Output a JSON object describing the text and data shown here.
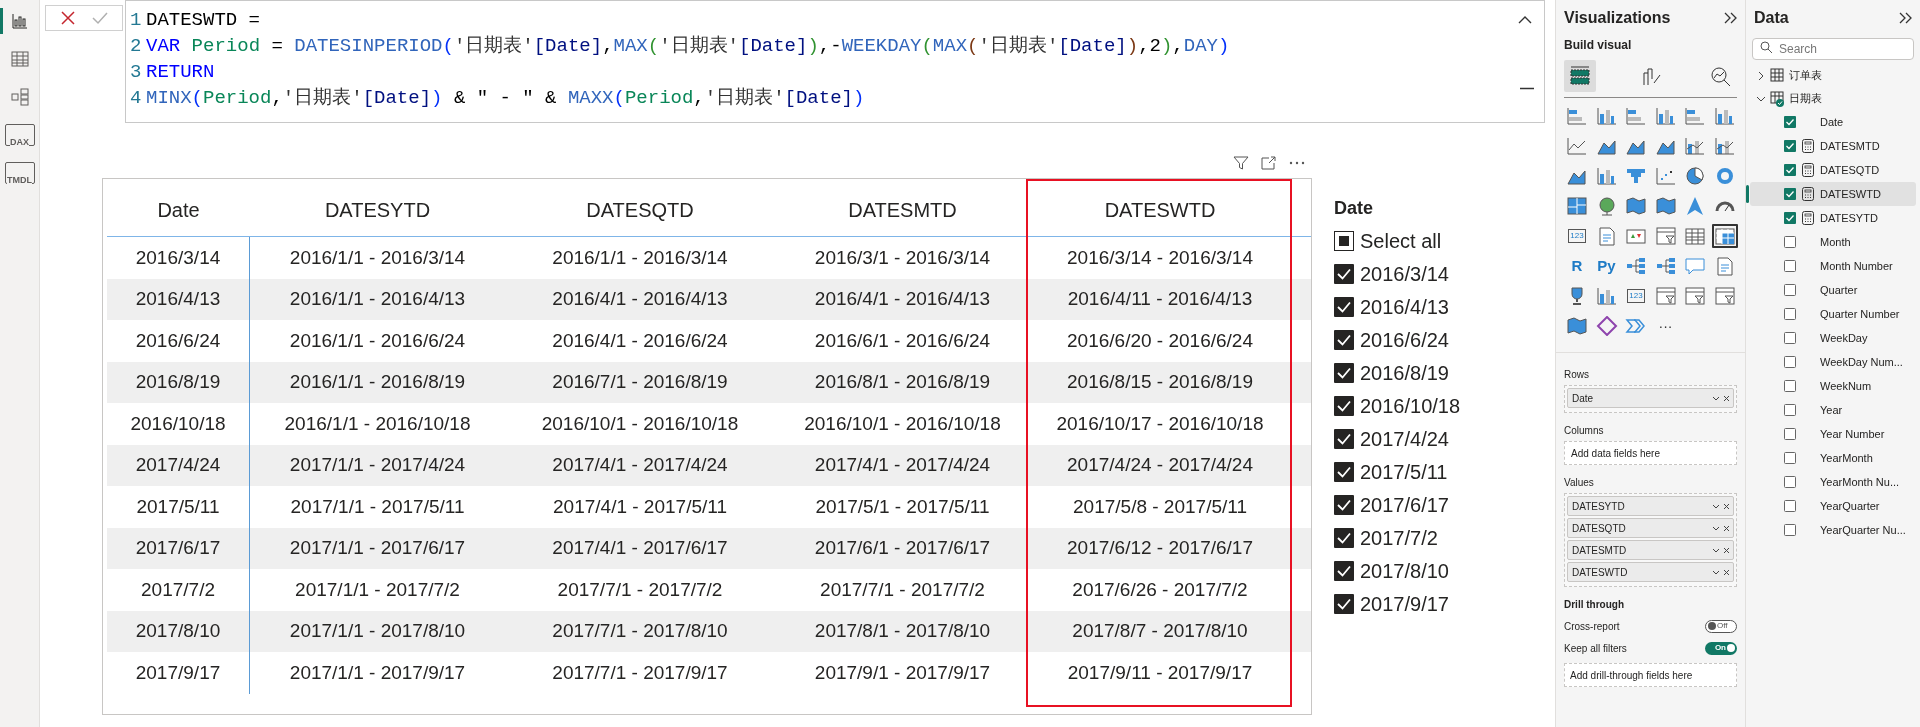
{
  "rail": [
    {
      "kind": "report",
      "selected": true
    },
    {
      "kind": "table",
      "selected": false
    },
    {
      "kind": "model",
      "selected": false
    },
    {
      "kind": "dax",
      "label": "DAX",
      "selected": false
    },
    {
      "kind": "tmdl",
      "label": "TMDL",
      "selected": false
    }
  ],
  "formula": {
    "lines": [
      {
        "number": "1",
        "tokens": [
          {
            "kind": "plain",
            "text": "DATESWTD ="
          }
        ]
      },
      {
        "number": "2",
        "tokens": [
          {
            "kind": "kw",
            "text": "VAR"
          },
          {
            "kind": "var",
            "text": " Period"
          },
          {
            "kind": "plain",
            "text": " = "
          },
          {
            "kind": "fn",
            "text": "DATESINPERIOD"
          },
          {
            "kind": "p1",
            "text": "("
          },
          {
            "kind": "tbl",
            "text": "'日期表'"
          },
          {
            "kind": "col",
            "text": "[Date]"
          },
          {
            "kind": "plain",
            "text": ","
          },
          {
            "kind": "fn",
            "text": "MAX"
          },
          {
            "kind": "p2",
            "text": "("
          },
          {
            "kind": "tbl",
            "text": "'日期表'"
          },
          {
            "kind": "col",
            "text": "[Date]"
          },
          {
            "kind": "p2",
            "text": ")"
          },
          {
            "kind": "plain",
            "text": ",-"
          },
          {
            "kind": "fn",
            "text": "WEEKDAY"
          },
          {
            "kind": "p2",
            "text": "("
          },
          {
            "kind": "fn",
            "text": "MAX"
          },
          {
            "kind": "p3",
            "text": "("
          },
          {
            "kind": "tbl",
            "text": "'日期表'"
          },
          {
            "kind": "col",
            "text": "[Date]"
          },
          {
            "kind": "p3",
            "text": ")"
          },
          {
            "kind": "plain",
            "text": ",2"
          },
          {
            "kind": "p2",
            "text": ")"
          },
          {
            "kind": "plain",
            "text": ","
          },
          {
            "kind": "fn",
            "text": "DAY"
          },
          {
            "kind": "p1",
            "text": ")"
          }
        ]
      },
      {
        "number": "3",
        "tokens": [
          {
            "kind": "kw",
            "text": "RETURN"
          }
        ]
      },
      {
        "number": "4",
        "tokens": [
          {
            "kind": "fn",
            "text": "MINX"
          },
          {
            "kind": "p1",
            "text": "("
          },
          {
            "kind": "var",
            "text": "Period"
          },
          {
            "kind": "plain",
            "text": ","
          },
          {
            "kind": "tbl",
            "text": "'日期表'"
          },
          {
            "kind": "col",
            "text": "[Date]"
          },
          {
            "kind": "p1",
            "text": ")"
          },
          {
            "kind": "plain",
            "text": " & \" - \" & "
          },
          {
            "kind": "fn",
            "text": "MAXX"
          },
          {
            "kind": "p1",
            "text": "("
          },
          {
            "kind": "var",
            "text": "Period"
          },
          {
            "kind": "plain",
            "text": ","
          },
          {
            "kind": "tbl",
            "text": "'日期表'"
          },
          {
            "kind": "col",
            "text": "[Date]"
          },
          {
            "kind": "p1",
            "text": ")"
          }
        ]
      }
    ]
  },
  "table": {
    "columns": [
      {
        "label": "Date",
        "highlighted": false
      },
      {
        "label": "DATESYTD",
        "highlighted": false
      },
      {
        "label": "DATESQTD",
        "highlighted": false
      },
      {
        "label": "DATESMTD",
        "highlighted": false
      },
      {
        "label": "DATESWTD",
        "highlighted": true
      }
    ],
    "rows": [
      [
        "2016/3/14",
        "2016/1/1 - 2016/3/14",
        "2016/1/1 - 2016/3/14",
        "2016/3/1 - 2016/3/14",
        "2016/3/14 - 2016/3/14"
      ],
      [
        "2016/4/13",
        "2016/1/1 - 2016/4/13",
        "2016/4/1 - 2016/4/13",
        "2016/4/1 - 2016/4/13",
        "2016/4/11 - 2016/4/13"
      ],
      [
        "2016/6/24",
        "2016/1/1 - 2016/6/24",
        "2016/4/1 - 2016/6/24",
        "2016/6/1 - 2016/6/24",
        "2016/6/20 - 2016/6/24"
      ],
      [
        "2016/8/19",
        "2016/1/1 - 2016/8/19",
        "2016/7/1 - 2016/8/19",
        "2016/8/1 - 2016/8/19",
        "2016/8/15 - 2016/8/19"
      ],
      [
        "2016/10/18",
        "2016/1/1 - 2016/10/18",
        "2016/10/1 - 2016/10/18",
        "2016/10/1 - 2016/10/18",
        "2016/10/17 - 2016/10/18"
      ],
      [
        "2017/4/24",
        "2017/1/1 - 2017/4/24",
        "2017/4/1 - 2017/4/24",
        "2017/4/1 - 2017/4/24",
        "2017/4/24 - 2017/4/24"
      ],
      [
        "2017/5/11",
        "2017/1/1 - 2017/5/11",
        "2017/4/1 - 2017/5/11",
        "2017/5/1 - 2017/5/11",
        "2017/5/8 - 2017/5/11"
      ],
      [
        "2017/6/17",
        "2017/1/1 - 2017/6/17",
        "2017/4/1 - 2017/6/17",
        "2017/6/1 - 2017/6/17",
        "2017/6/12 - 2017/6/17"
      ],
      [
        "2017/7/2",
        "2017/1/1 - 2017/7/2",
        "2017/7/1 - 2017/7/2",
        "2017/7/1 - 2017/7/2",
        "2017/6/26 - 2017/7/2"
      ],
      [
        "2017/8/10",
        "2017/1/1 - 2017/8/10",
        "2017/7/1 - 2017/8/10",
        "2017/8/1 - 2017/8/10",
        "2017/8/7 - 2017/8/10"
      ],
      [
        "2017/9/17",
        "2017/1/1 - 2017/9/17",
        "2017/7/1 - 2017/9/17",
        "2017/9/1 - 2017/9/17",
        "2017/9/11 - 2017/9/17"
      ]
    ]
  },
  "slicer": {
    "title": "Date",
    "select_all": {
      "label": "Select all",
      "indeterminate": true
    },
    "items": [
      {
        "label": "2016/3/14",
        "checked": true
      },
      {
        "label": "2016/4/13",
        "checked": true
      },
      {
        "label": "2016/6/24",
        "checked": true
      },
      {
        "label": "2016/8/19",
        "checked": true
      },
      {
        "label": "2016/10/18",
        "checked": true
      },
      {
        "label": "2017/4/24",
        "checked": true
      },
      {
        "label": "2017/5/11",
        "checked": true
      },
      {
        "label": "2017/6/17",
        "checked": true
      },
      {
        "label": "2017/7/2",
        "checked": true
      },
      {
        "label": "2017/8/10",
        "checked": true
      },
      {
        "label": "2017/9/17",
        "checked": true
      }
    ]
  },
  "visualizations": {
    "title": "Visualizations",
    "subtitle": "Build visual",
    "build_tabs": [
      {
        "kind": "build",
        "selected": true
      },
      {
        "kind": "format",
        "selected": false
      },
      {
        "kind": "analytics",
        "selected": false
      }
    ],
    "gallery": [
      {
        "kind": "hbar",
        "selected": false
      },
      {
        "kind": "vbar",
        "selected": false
      },
      {
        "kind": "hbar",
        "selected": false
      },
      {
        "kind": "vbar",
        "selected": false
      },
      {
        "kind": "hbar",
        "selected": false
      },
      {
        "kind": "vbar",
        "selected": false
      },
      {
        "kind": "line",
        "selected": false
      },
      {
        "kind": "area",
        "selected": false
      },
      {
        "kind": "area",
        "selected": false
      },
      {
        "kind": "area",
        "selected": false
      },
      {
        "kind": "linecol",
        "selected": false
      },
      {
        "kind": "linecol",
        "selected": false
      },
      {
        "kind": "area",
        "selected": false
      },
      {
        "kind": "vbar",
        "selected": false
      },
      {
        "kind": "funnel",
        "selected": false
      },
      {
        "kind": "scatter",
        "selected": false
      },
      {
        "kind": "pie",
        "selected": false
      },
      {
        "kind": "donut",
        "selected": false
      },
      {
        "kind": "treemap",
        "selected": false
      },
      {
        "kind": "globe",
        "selected": false
      },
      {
        "kind": "map",
        "selected": false
      },
      {
        "kind": "map",
        "selected": false
      },
      {
        "kind": "arrow",
        "selected": false
      },
      {
        "kind": "gauge",
        "selected": false
      },
      {
        "kind": "card",
        "label": "123",
        "selected": false
      },
      {
        "kind": "doc",
        "selected": false
      },
      {
        "kind": "kpi",
        "selected": false
      },
      {
        "kind": "slicer",
        "selected": false
      },
      {
        "kind": "table",
        "selected": false
      },
      {
        "kind": "matrix",
        "selected": true
      },
      {
        "kind": "letter",
        "label": "R",
        "selected": false
      },
      {
        "kind": "letter",
        "label": "Py",
        "selected": false
      },
      {
        "kind": "tree",
        "selected": false
      },
      {
        "kind": "tree",
        "selected": false
      },
      {
        "kind": "bubble",
        "selected": false
      },
      {
        "kind": "doc",
        "selected": false
      },
      {
        "kind": "trophy",
        "selected": false
      },
      {
        "kind": "vbar",
        "selected": false
      },
      {
        "kind": "card",
        "label": "123",
        "selected": false
      },
      {
        "kind": "slicer",
        "selected": false
      },
      {
        "kind": "slicer",
        "selected": false
      },
      {
        "kind": "slicer",
        "selected": false
      },
      {
        "kind": "map",
        "selected": false
      },
      {
        "kind": "diamond",
        "selected": false
      },
      {
        "kind": "chevrons",
        "selected": false
      },
      {
        "kind": "more",
        "label": "···",
        "selected": false
      }
    ],
    "wells": [
      {
        "label": "Rows",
        "fields": [
          "Date"
        ]
      },
      {
        "label": "Columns",
        "placeholder": "Add data fields here"
      },
      {
        "label": "Values",
        "fields": [
          "DATESYTD",
          "DATESQTD",
          "DATESMTD",
          "DATESWTD"
        ]
      }
    ],
    "drill_through": {
      "title": "Drill through",
      "toggles": [
        {
          "label": "Cross-report",
          "on": false,
          "state_text": "Off"
        },
        {
          "label": "Keep all filters",
          "on": true,
          "state_text": "On"
        }
      ],
      "placeholder": "Add drill-through fields here"
    }
  },
  "data": {
    "title": "Data",
    "search": {
      "placeholder": "Search"
    },
    "tables": [
      {
        "name": "订单表",
        "expanded": false,
        "kind": "table"
      },
      {
        "name": "日期表",
        "expanded": true,
        "kind": "datetable",
        "children": [
          {
            "name": "Date",
            "kind": "column",
            "checked": true,
            "selected": false
          },
          {
            "name": "DATESMTD",
            "kind": "measure",
            "checked": true,
            "selected": false
          },
          {
            "name": "DATESQTD",
            "kind": "measure",
            "checked": true,
            "selected": false
          },
          {
            "name": "DATESWTD",
            "kind": "measure",
            "checked": true,
            "selected": true
          },
          {
            "name": "DATESYTD",
            "kind": "measure",
            "checked": true,
            "selected": false
          },
          {
            "name": "Month",
            "kind": "column",
            "checked": false,
            "selected": false
          },
          {
            "name": "Month Number",
            "kind": "column",
            "checked": false,
            "selected": false
          },
          {
            "name": "Quarter",
            "kind": "column",
            "checked": false,
            "selected": false
          },
          {
            "name": "Quarter Number",
            "kind": "column",
            "checked": false,
            "selected": false
          },
          {
            "name": "WeekDay",
            "kind": "column",
            "checked": false,
            "selected": false
          },
          {
            "name": "WeekDay Num...",
            "kind": "column",
            "checked": false,
            "selected": false
          },
          {
            "name": "WeekNum",
            "kind": "column",
            "checked": false,
            "selected": false
          },
          {
            "name": "Year",
            "kind": "column",
            "checked": false,
            "selected": false
          },
          {
            "name": "Year Number",
            "kind": "column",
            "checked": false,
            "selected": false
          },
          {
            "name": "YearMonth",
            "kind": "column",
            "checked": false,
            "selected": false
          },
          {
            "name": "YearMonth Nu...",
            "kind": "column",
            "checked": false,
            "selected": false
          },
          {
            "name": "YearQuarter",
            "kind": "column",
            "checked": false,
            "selected": false
          },
          {
            "name": "YearQuarter Nu...",
            "kind": "column",
            "checked": false,
            "selected": false
          }
        ]
      }
    ]
  }
}
